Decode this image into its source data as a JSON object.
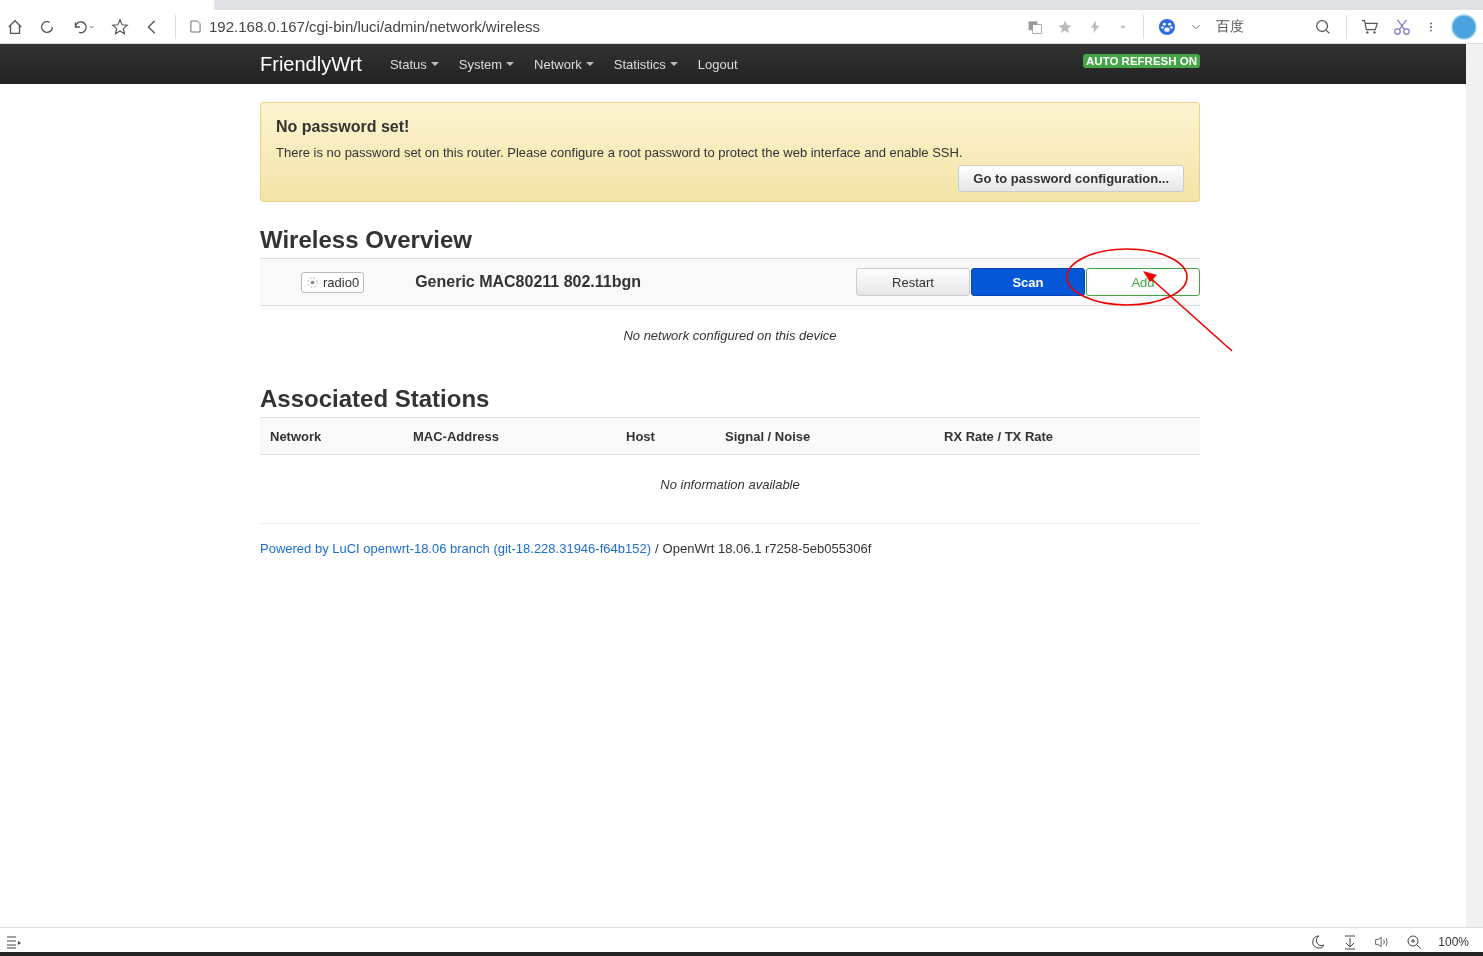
{
  "browser": {
    "url": "192.168.0.167/cgi-bin/luci/admin/network/wireless",
    "search_engine": "百度",
    "zoom": "100%"
  },
  "navbar": {
    "brand": "FriendlyWrt",
    "menus": [
      {
        "label": "Status",
        "dropdown": true
      },
      {
        "label": "System",
        "dropdown": true
      },
      {
        "label": "Network",
        "dropdown": true
      },
      {
        "label": "Statistics",
        "dropdown": true
      },
      {
        "label": "Logout",
        "dropdown": false
      }
    ],
    "indicator": "AUTO REFRESH ON"
  },
  "alert": {
    "title": "No password set!",
    "message": "There is no password set on this router. Please configure a root password to protect the web interface and enable SSH.",
    "button": "Go to password configuration..."
  },
  "wireless": {
    "title": "Wireless Overview",
    "device": {
      "badge": "radio0",
      "name": "Generic MAC80211 802.11bgn"
    },
    "buttons": [
      {
        "label": "Restart",
        "kind": "default"
      },
      {
        "label": "Scan",
        "kind": "primary"
      },
      {
        "label": "Add",
        "kind": "success"
      }
    ],
    "empty": "No network configured on this device"
  },
  "stations": {
    "title": "Associated Stations",
    "columns": [
      "Network",
      "MAC-Address",
      "Host",
      "Signal / Noise",
      "RX Rate / TX Rate"
    ],
    "empty": "No information available"
  },
  "footer": {
    "link": "Powered by LuCI openwrt-18.06 branch (git-18.228.31946-f64b152)",
    "separator": "/",
    "version": "OpenWrt 18.06.1 r7258-5eb055306f"
  }
}
